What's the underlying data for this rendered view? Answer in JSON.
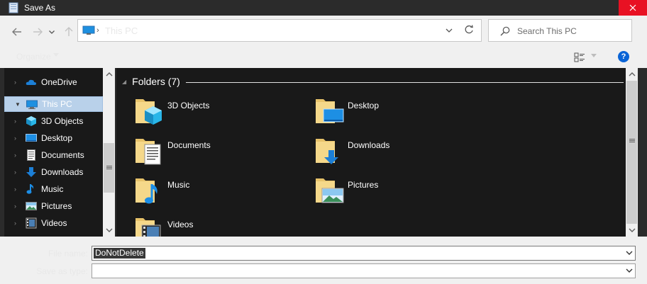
{
  "window": {
    "title": "Save As"
  },
  "address": {
    "path": "This PC"
  },
  "search": {
    "placeholder": "Search This PC"
  },
  "commands": {
    "organize": "Organize"
  },
  "nav_pane": {
    "items": [
      {
        "label": "OneDrive",
        "icon": "onedrive-icon"
      },
      {
        "label": "This PC",
        "icon": "this-pc-icon",
        "selected": true
      },
      {
        "label": "3D Objects",
        "icon": "3d-objects-icon"
      },
      {
        "label": "Desktop",
        "icon": "desktop-icon"
      },
      {
        "label": "Documents",
        "icon": "documents-icon"
      },
      {
        "label": "Downloads",
        "icon": "downloads-icon"
      },
      {
        "label": "Music",
        "icon": "music-icon"
      },
      {
        "label": "Pictures",
        "icon": "pictures-icon"
      },
      {
        "label": "Videos",
        "icon": "videos-icon"
      }
    ]
  },
  "content": {
    "group_title": "Folders (7)",
    "folders": [
      {
        "label": "3D Objects",
        "icon": "3d-objects-folder-icon"
      },
      {
        "label": "Desktop",
        "icon": "desktop-folder-icon"
      },
      {
        "label": "Documents",
        "icon": "documents-folder-icon"
      },
      {
        "label": "Downloads",
        "icon": "downloads-folder-icon"
      },
      {
        "label": "Music",
        "icon": "music-folder-icon"
      },
      {
        "label": "Pictures",
        "icon": "pictures-folder-icon"
      },
      {
        "label": "Videos",
        "icon": "videos-folder-icon"
      }
    ]
  },
  "form": {
    "file_name_label": "File name:",
    "file_name_value": "DoNotDelete",
    "save_type_label": "Save as type:",
    "save_type_value": ""
  },
  "colors": {
    "close_button": "#e81123",
    "selection": "#b9d1ea",
    "dark_pane": "#191919",
    "help": "#0a64d6"
  }
}
